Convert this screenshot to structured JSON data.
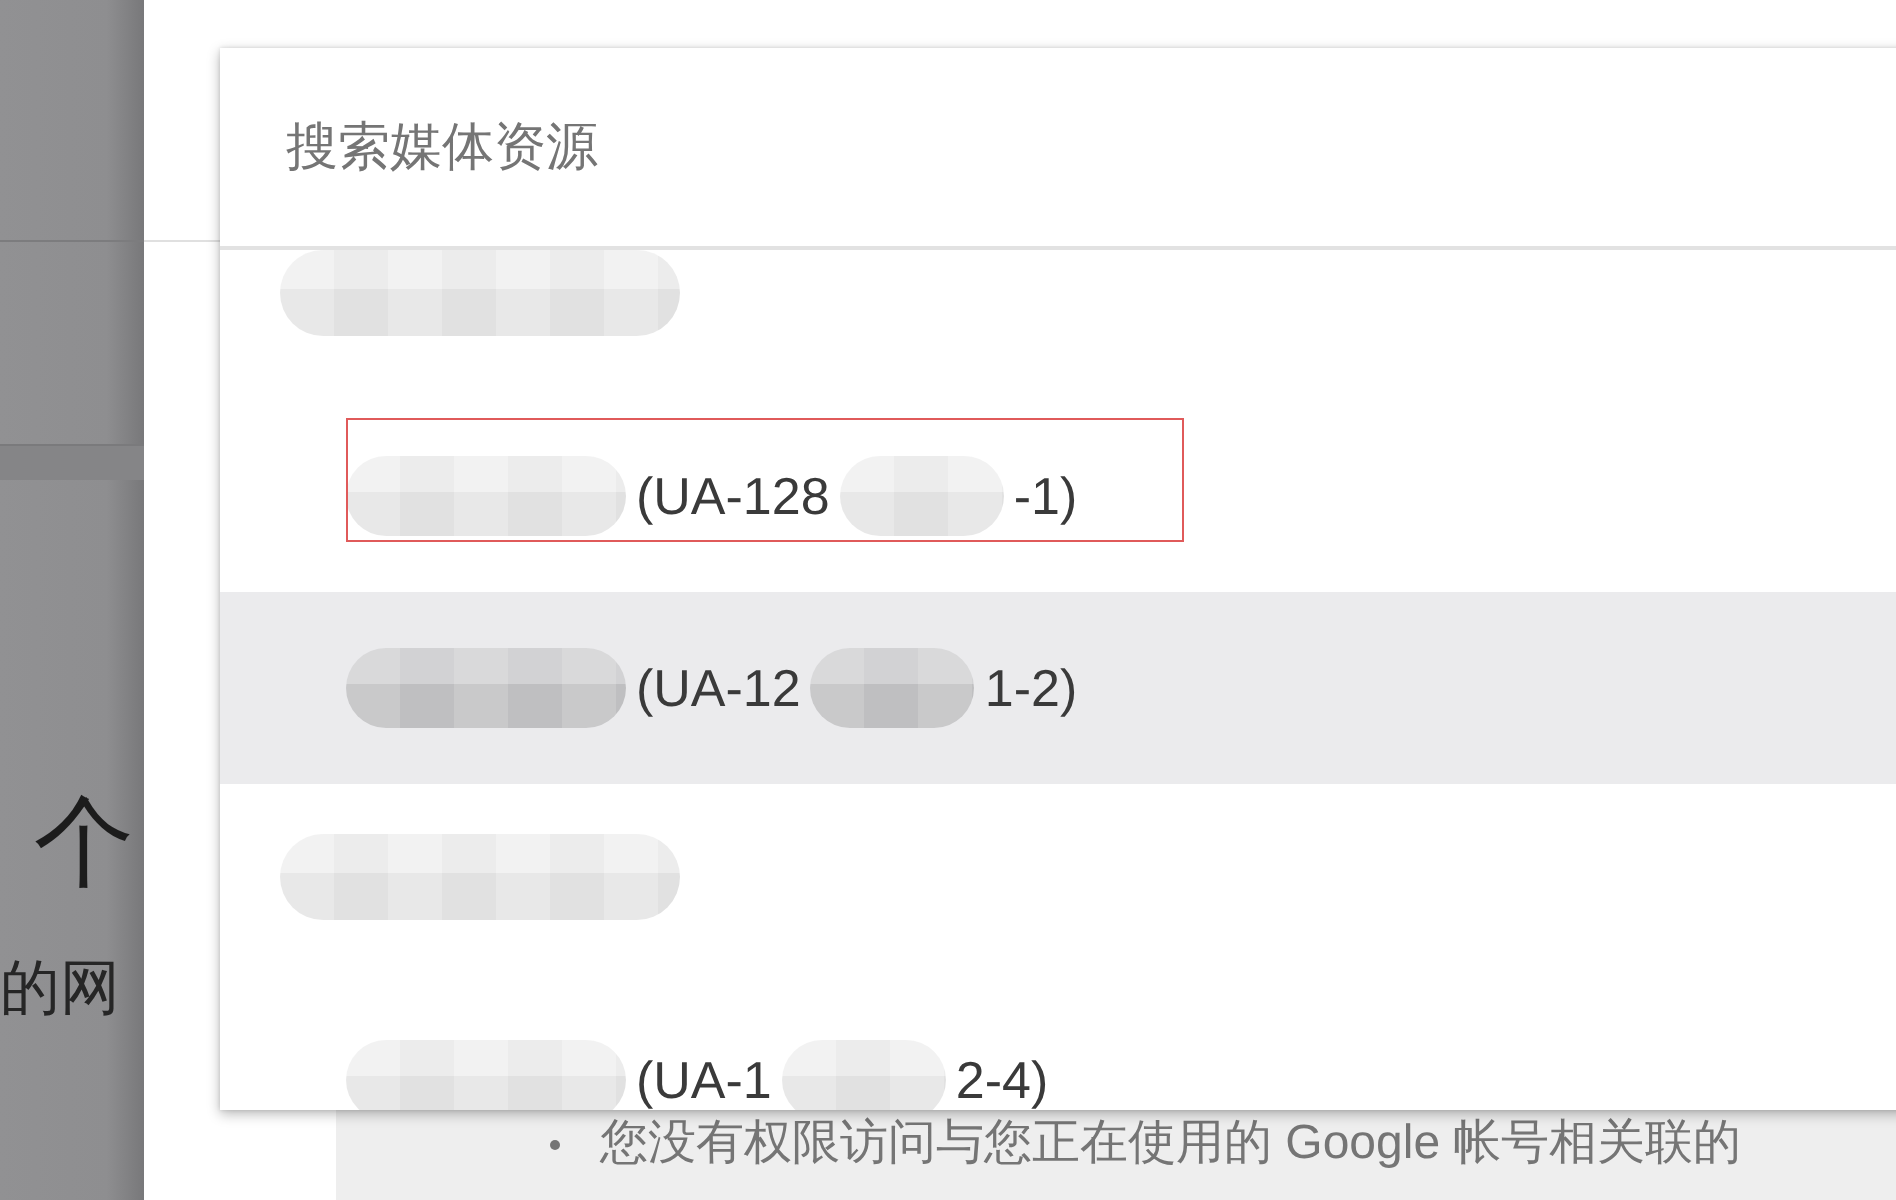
{
  "backdrop": {
    "heading": "个",
    "subheading": "的网"
  },
  "search": {
    "placeholder": "搜索媒体资源"
  },
  "rows": [
    {
      "kind": "group",
      "parts": [
        {
          "kind": "redacted"
        }
      ]
    },
    {
      "kind": "property",
      "selected": false,
      "annotated": true,
      "parts": [
        {
          "kind": "redacted"
        },
        {
          "kind": "text",
          "text": "(UA-128"
        },
        {
          "kind": "redacted"
        },
        {
          "kind": "text",
          "text": "-1)"
        }
      ]
    },
    {
      "kind": "property",
      "selected": true,
      "annotated": false,
      "parts": [
        {
          "kind": "redacted"
        },
        {
          "kind": "text",
          "text": "(UA-12"
        },
        {
          "kind": "redacted"
        },
        {
          "kind": "text",
          "text": "1-2)"
        }
      ]
    },
    {
      "kind": "group",
      "parts": [
        {
          "kind": "redacted"
        }
      ]
    },
    {
      "kind": "property",
      "selected": false,
      "annotated": false,
      "parts": [
        {
          "kind": "redacted"
        },
        {
          "kind": "text",
          "text": "(UA-1"
        },
        {
          "kind": "redacted"
        },
        {
          "kind": "text",
          "text": "2-4)"
        }
      ]
    }
  ],
  "notice": {
    "text": "您没有权限访问与您正在使用的 Google 帐号相关联的"
  }
}
